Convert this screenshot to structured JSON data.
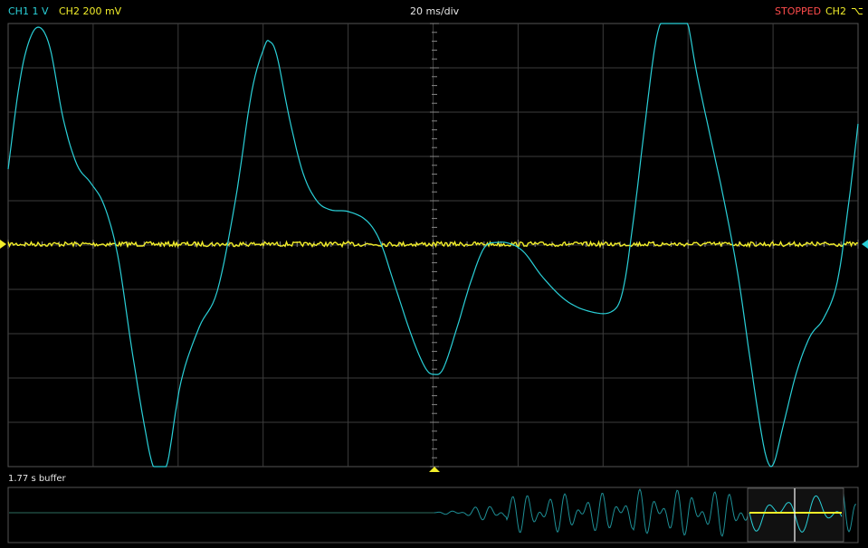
{
  "header": {
    "ch1_label": "CH1 1 V",
    "ch2_label": "CH2 200 mV",
    "timebase": "20 ms/div",
    "status": "STOPPED",
    "trigger_source": "CH2",
    "trigger_edge_icon": "falling-edge-icon",
    "trigger_edge_glyph": "⌥"
  },
  "colors": {
    "ch1": "#2ad0d8",
    "ch2": "#f2ee2a",
    "status": "#ff4c4c",
    "grid": "#3c3c3c",
    "background": "#000000"
  },
  "buffer": {
    "label": "1.77 s buffer"
  }
}
